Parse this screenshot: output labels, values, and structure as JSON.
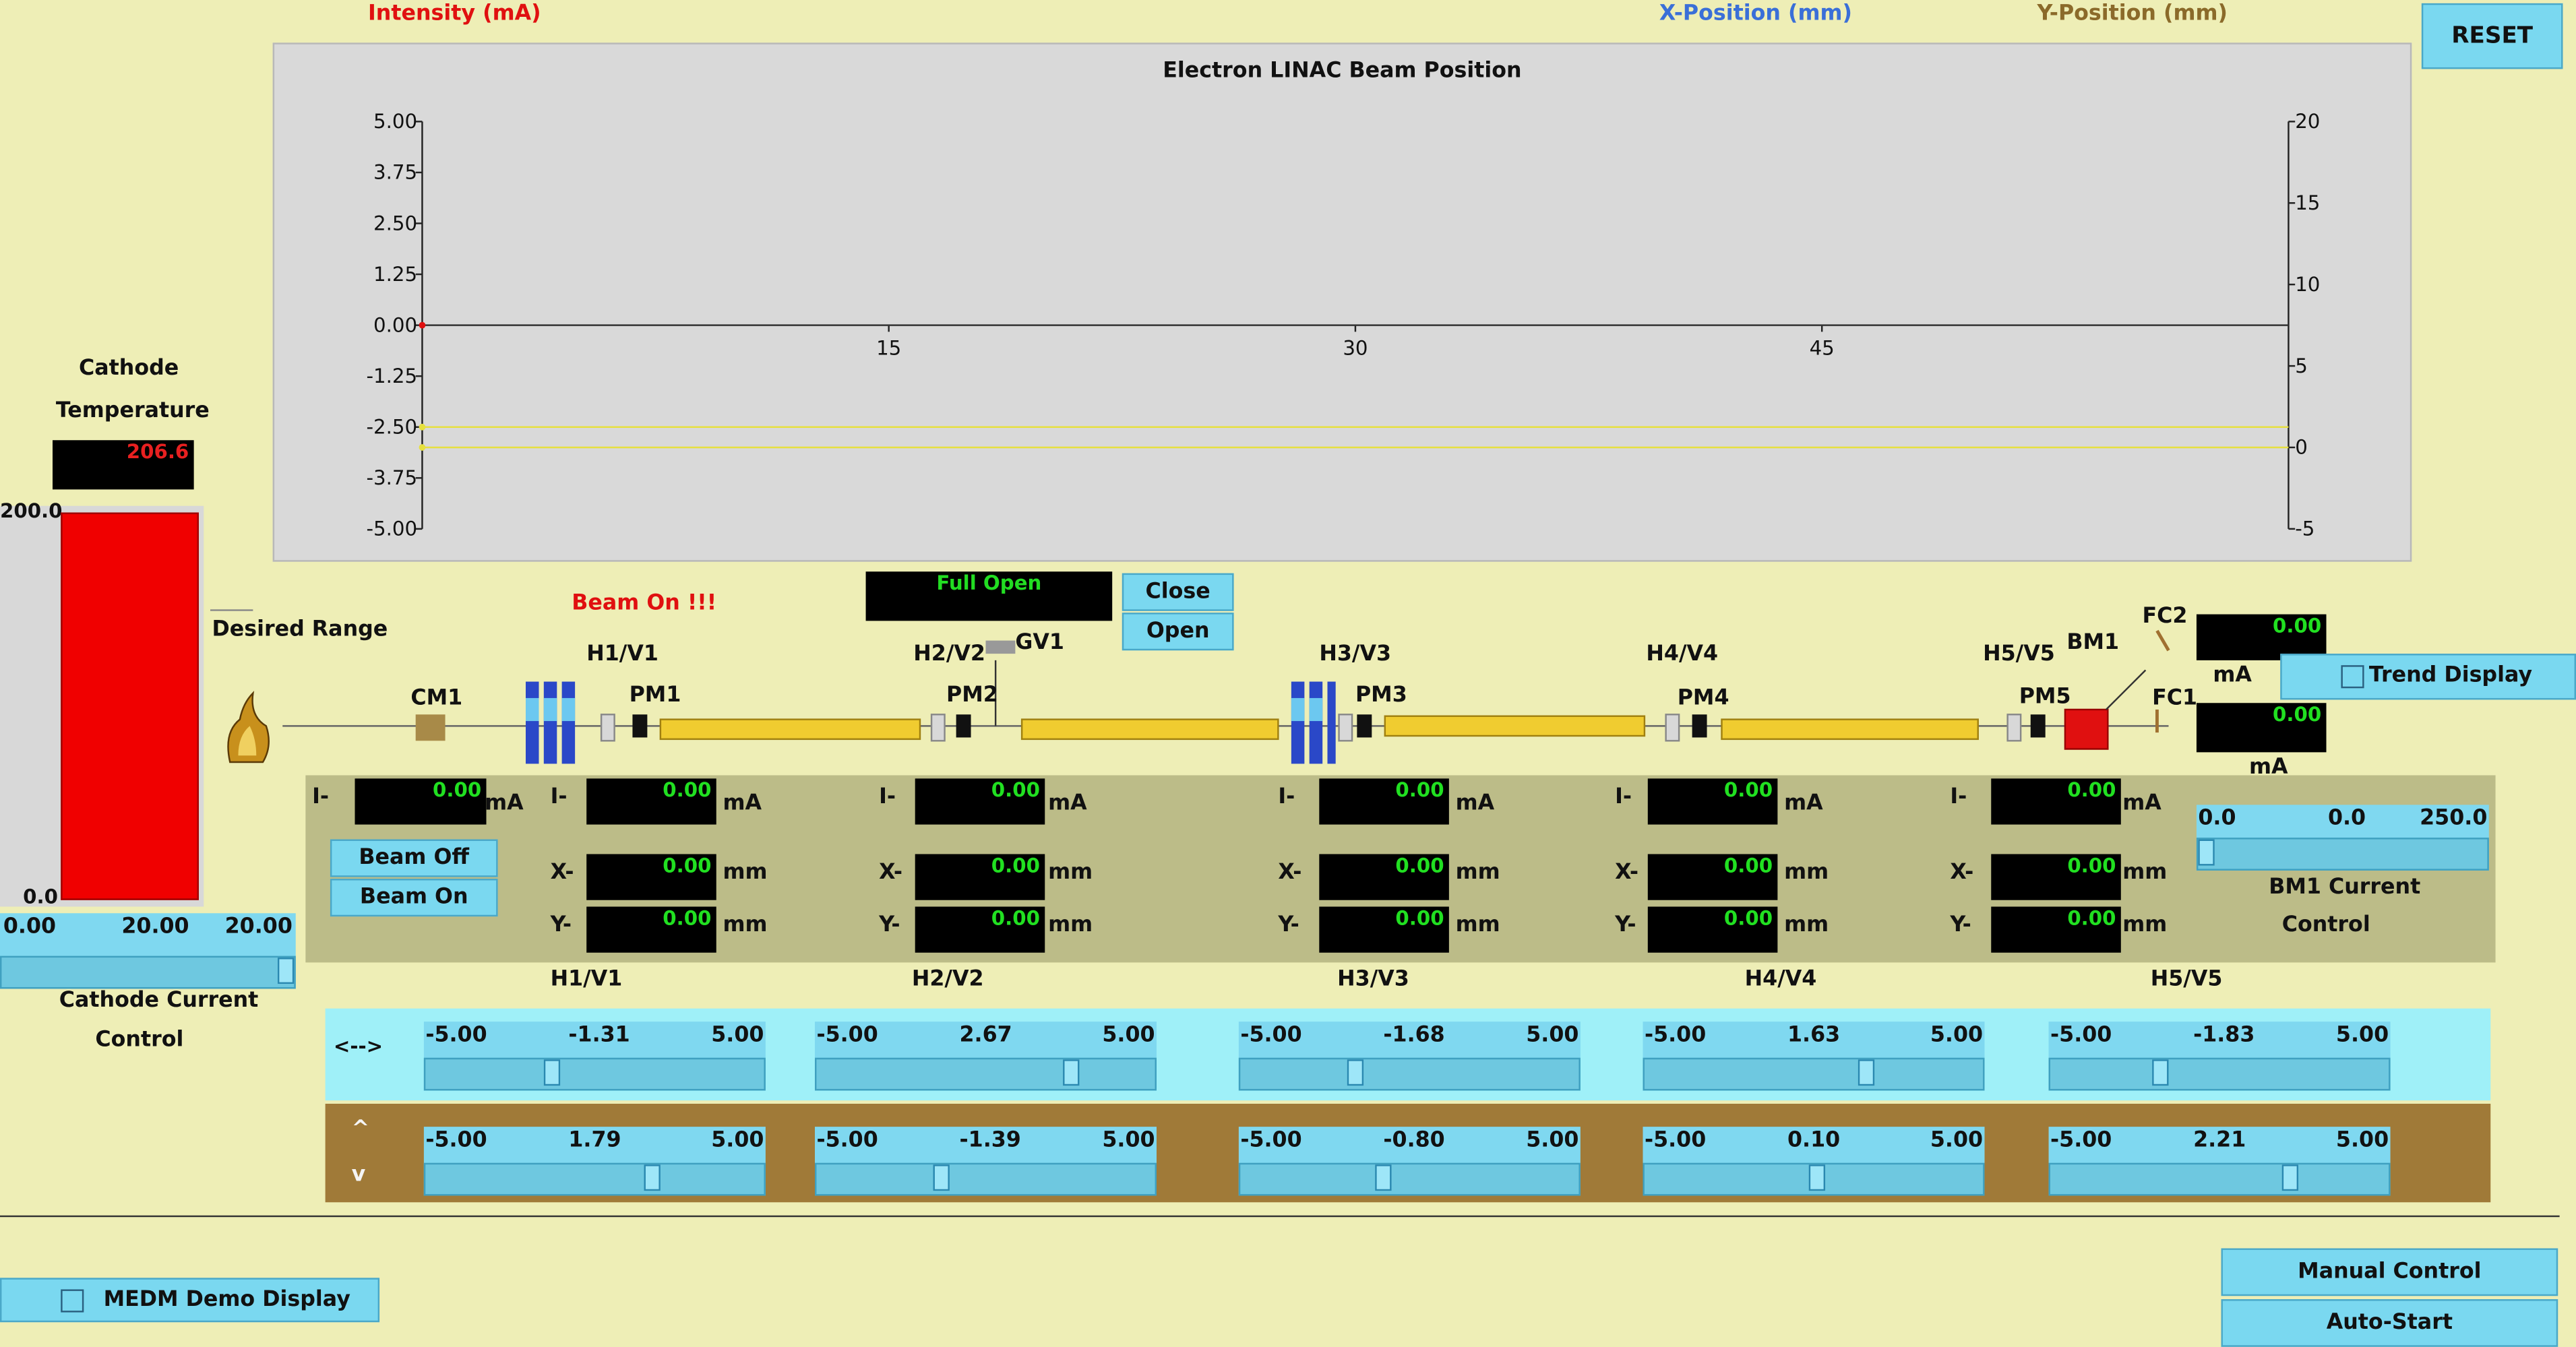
{
  "header": {
    "intensity_label": "Intensity (mA)",
    "x_position_label": "X-Position (mm)",
    "y_position_label": "Y-Position (mm)",
    "reset_label": "RESET",
    "intensity_color": "#e01010",
    "x_color": "#3a6fd8",
    "y_color": "#8b6a2a"
  },
  "chart_data": {
    "type": "line",
    "title": "Electron LINAC Beam Position",
    "left_ticks": [
      "5.00",
      "3.75",
      "2.50",
      "1.25",
      "0.00",
      "-1.25",
      "-2.50",
      "-3.75",
      "-5.00"
    ],
    "right_ticks": [
      "20",
      "15",
      "10",
      "5",
      "0",
      "-5"
    ],
    "x_ticks": [
      "15",
      "30",
      "45"
    ],
    "ylim_left": [
      -5,
      5
    ],
    "ylim_right": [
      -5,
      20
    ],
    "xlim": [
      0,
      60
    ],
    "series": [
      {
        "x": [
          0,
          60
        ],
        "y": [
          0,
          0
        ],
        "color": "#e01010"
      },
      {
        "x": [
          0,
          60
        ],
        "y": [
          -2.5,
          -2.5
        ],
        "color": "#e6e040"
      },
      {
        "x": [
          0,
          60
        ],
        "y": [
          -3.0,
          -3.0
        ],
        "color": "#e6e040"
      }
    ],
    "grid": false
  },
  "cathode": {
    "title_line1": "Cathode",
    "title_line2": "Temperature",
    "temperature": "206.6",
    "bar_max": "200.0",
    "bar_min": "0.0",
    "bar_fraction": 1.0,
    "desired_range": "Desired Range",
    "current_min": "0.00",
    "current_value": "20.00",
    "current_max": "20.00",
    "current_fraction": 1.0,
    "control_line1": "Cathode Current",
    "control_line2": "Control"
  },
  "beamline": {
    "beam_status": "Beam On !!!",
    "gate_status": "Full Open",
    "close_label": "Close",
    "open_label": "Open",
    "gv1": "GV1",
    "cm1": "CM1",
    "fc1": "FC1",
    "fc2": "FC2",
    "bm1": "BM1",
    "fc2_value": "0.00",
    "fc1_value": "0.00",
    "ma": "mA",
    "trend_label": "Trend Display",
    "magnets": [
      "H1/V1",
      "H2/V2",
      "H3/V3",
      "H4/V4",
      "H5/V5"
    ],
    "monitors": [
      "PM1",
      "PM2",
      "PM3",
      "PM4",
      "PM5"
    ]
  },
  "readouts": {
    "i_label": "I-",
    "x_label": "X-",
    "y_label": "Y-",
    "ma": "mA",
    "mm": "mm",
    "cm_i": "0.00",
    "pm": [
      {
        "i": "0.00",
        "x": "0.00",
        "y": "0.00",
        "name": "H1/V1"
      },
      {
        "i": "0.00",
        "x": "0.00",
        "y": "0.00",
        "name": "H2/V2"
      },
      {
        "i": "0.00",
        "x": "0.00",
        "y": "0.00",
        "name": "H3/V3"
      },
      {
        "i": "0.00",
        "x": "0.00",
        "y": "0.00",
        "name": "H4/V4"
      },
      {
        "i": "0.00",
        "x": "0.00",
        "y": "0.00",
        "name": "H5/V5"
      }
    ],
    "beam_off": "Beam Off",
    "beam_on": "Beam On",
    "bm1_min": "0.0",
    "bm1_value": "0.0",
    "bm1_max": "250.0",
    "bm1_fraction": 0.0,
    "bm1_line1": "BM1 Current",
    "bm1_line2": "Control"
  },
  "steering": {
    "h_symbol": "<-->",
    "v_symbol_top": "^",
    "v_symbol_bottom": "v",
    "min": "-5.00",
    "max": "5.00",
    "horizontal": [
      "-1.31",
      "2.67",
      "-1.68",
      "1.63",
      "-1.83"
    ],
    "vertical": [
      "1.79",
      "-1.39",
      "-0.80",
      "0.10",
      "2.21"
    ],
    "h_band_color": "#9ff0f8",
    "v_band_color": "#a07a38"
  },
  "footer": {
    "medm_label": "MEDM Demo Display",
    "manual_label": "Manual Control",
    "autostart_label": "Auto-Start"
  }
}
